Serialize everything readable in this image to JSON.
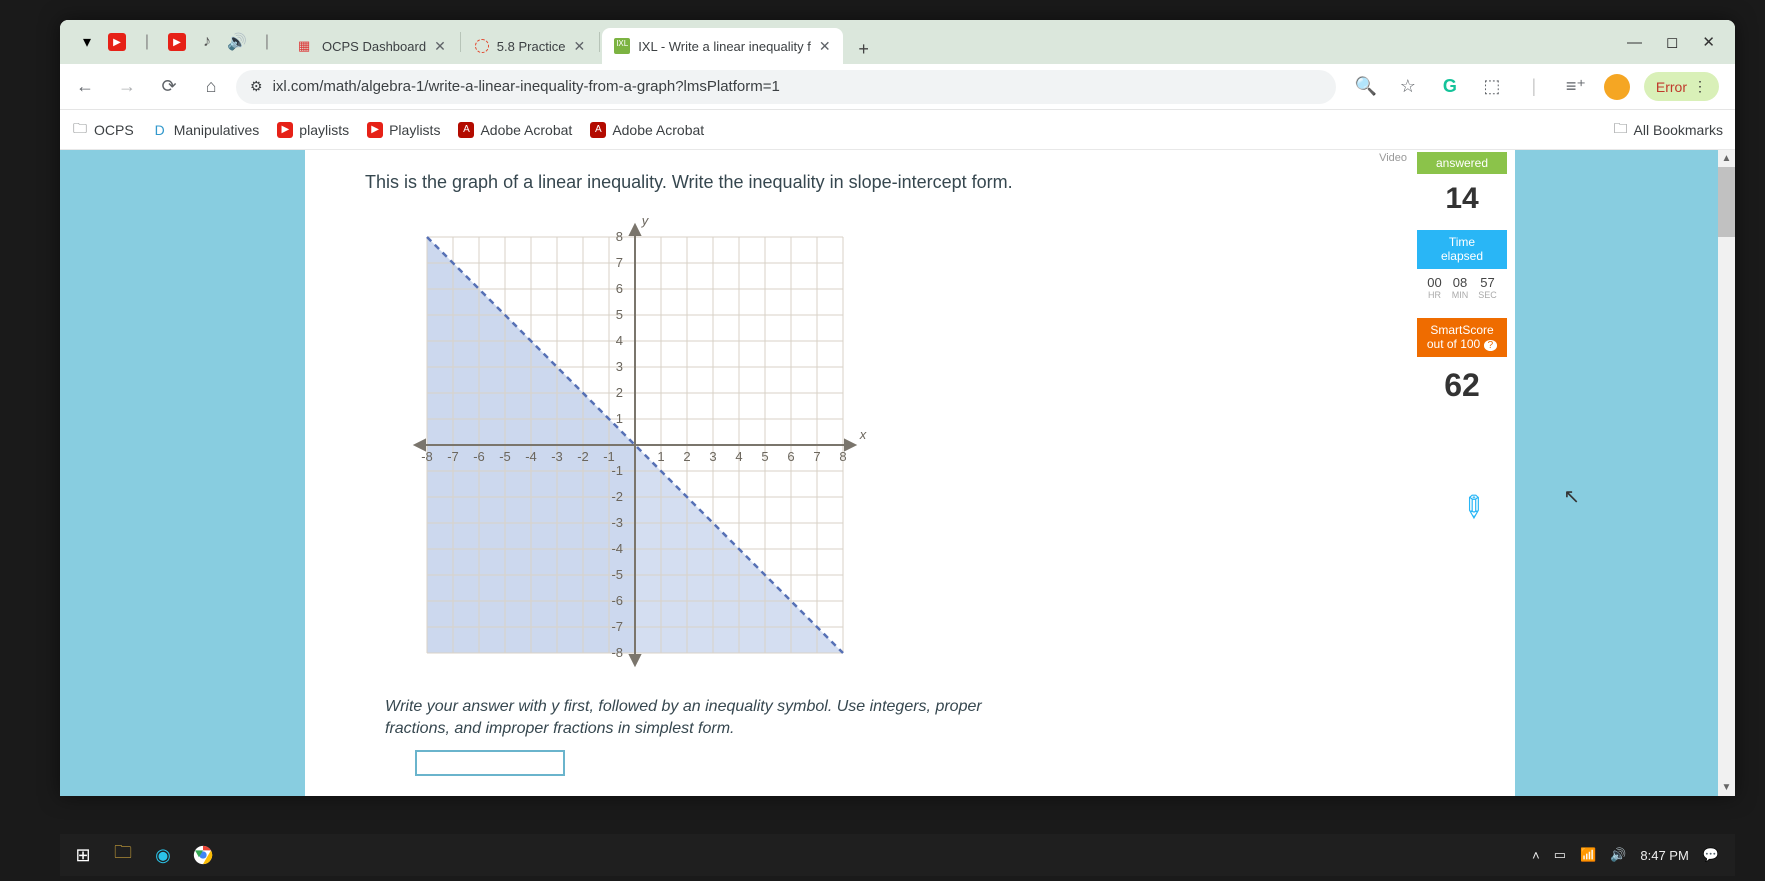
{
  "tabs": [
    {
      "title": "OCPS Dashboard",
      "favicon": "grid",
      "active": false
    },
    {
      "title": "5.8 Practice",
      "favicon": "canvas",
      "active": false
    },
    {
      "title": "IXL - Write a linear inequality f",
      "favicon": "ixl",
      "active": true
    }
  ],
  "address": {
    "url": "ixl.com/math/algebra-1/write-a-linear-inequality-from-a-graph?lmsPlatform=1",
    "error_label": "Error"
  },
  "bookmarks": [
    {
      "label": "OCPS",
      "icon": "folder-cloud"
    },
    {
      "label": "Manipulatives",
      "icon": "di"
    },
    {
      "label": "playlists",
      "icon": "yt"
    },
    {
      "label": "Playlists",
      "icon": "yt"
    },
    {
      "label": "Adobe Acrobat",
      "icon": "adobe"
    },
    {
      "label": "Adobe Acrobat",
      "icon": "adobe"
    }
  ],
  "all_bookmarks_label": "All Bookmarks",
  "question_text": "This is the graph of a linear inequality. Write the inequality in slope-intercept form.",
  "instruction_text": "Write your answer with y first, followed by an inequality symbol. Use integers, proper fractions, and improper fractions in simplest form.",
  "video_chip": "Video",
  "stats": {
    "answered_label": "answered",
    "answered_value": "14",
    "time_label_1": "Time",
    "time_label_2": "elapsed",
    "time": {
      "hr": "00",
      "min": "08",
      "sec": "57",
      "hr_l": "HR",
      "min_l": "MIN",
      "sec_l": "SEC"
    },
    "smart_label_1": "SmartScore",
    "smart_label_2": "out of 100",
    "smart_value": "62"
  },
  "taskbar": {
    "clock": "8:47 PM"
  },
  "chart_data": {
    "type": "inequality_graph",
    "x_range": [
      -8,
      8
    ],
    "y_range": [
      -8,
      8
    ],
    "x_ticks": [
      -8,
      -7,
      -6,
      -5,
      -4,
      -3,
      -2,
      -1,
      1,
      2,
      3,
      4,
      5,
      6,
      7,
      8
    ],
    "y_ticks": [
      -8,
      -7,
      -6,
      -5,
      -4,
      -3,
      -2,
      -1,
      1,
      2,
      3,
      4,
      5,
      6,
      7,
      8
    ],
    "xlabel": "x",
    "ylabel": "y",
    "boundary_line": {
      "slope": -1,
      "intercept": 0,
      "style": "dashed"
    },
    "shaded_region": "below",
    "inequality_depicted": "y < -x"
  }
}
